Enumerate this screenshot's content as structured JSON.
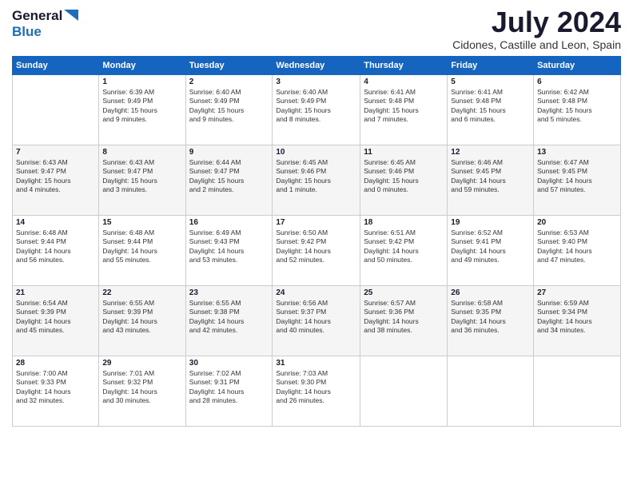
{
  "header": {
    "logo_general": "General",
    "logo_blue": "Blue",
    "month_title": "July 2024",
    "location": "Cidones, Castille and Leon, Spain"
  },
  "calendar": {
    "days_of_week": [
      "Sunday",
      "Monday",
      "Tuesday",
      "Wednesday",
      "Thursday",
      "Friday",
      "Saturday"
    ],
    "weeks": [
      [
        {
          "day": "",
          "info": ""
        },
        {
          "day": "1",
          "info": "Sunrise: 6:39 AM\nSunset: 9:49 PM\nDaylight: 15 hours\nand 9 minutes."
        },
        {
          "day": "2",
          "info": "Sunrise: 6:40 AM\nSunset: 9:49 PM\nDaylight: 15 hours\nand 9 minutes."
        },
        {
          "day": "3",
          "info": "Sunrise: 6:40 AM\nSunset: 9:49 PM\nDaylight: 15 hours\nand 8 minutes."
        },
        {
          "day": "4",
          "info": "Sunrise: 6:41 AM\nSunset: 9:48 PM\nDaylight: 15 hours\nand 7 minutes."
        },
        {
          "day": "5",
          "info": "Sunrise: 6:41 AM\nSunset: 9:48 PM\nDaylight: 15 hours\nand 6 minutes."
        },
        {
          "day": "6",
          "info": "Sunrise: 6:42 AM\nSunset: 9:48 PM\nDaylight: 15 hours\nand 5 minutes."
        }
      ],
      [
        {
          "day": "7",
          "info": "Sunrise: 6:43 AM\nSunset: 9:47 PM\nDaylight: 15 hours\nand 4 minutes."
        },
        {
          "day": "8",
          "info": "Sunrise: 6:43 AM\nSunset: 9:47 PM\nDaylight: 15 hours\nand 3 minutes."
        },
        {
          "day": "9",
          "info": "Sunrise: 6:44 AM\nSunset: 9:47 PM\nDaylight: 15 hours\nand 2 minutes."
        },
        {
          "day": "10",
          "info": "Sunrise: 6:45 AM\nSunset: 9:46 PM\nDaylight: 15 hours\nand 1 minute."
        },
        {
          "day": "11",
          "info": "Sunrise: 6:45 AM\nSunset: 9:46 PM\nDaylight: 15 hours\nand 0 minutes."
        },
        {
          "day": "12",
          "info": "Sunrise: 6:46 AM\nSunset: 9:45 PM\nDaylight: 14 hours\nand 59 minutes."
        },
        {
          "day": "13",
          "info": "Sunrise: 6:47 AM\nSunset: 9:45 PM\nDaylight: 14 hours\nand 57 minutes."
        }
      ],
      [
        {
          "day": "14",
          "info": "Sunrise: 6:48 AM\nSunset: 9:44 PM\nDaylight: 14 hours\nand 56 minutes."
        },
        {
          "day": "15",
          "info": "Sunrise: 6:48 AM\nSunset: 9:44 PM\nDaylight: 14 hours\nand 55 minutes."
        },
        {
          "day": "16",
          "info": "Sunrise: 6:49 AM\nSunset: 9:43 PM\nDaylight: 14 hours\nand 53 minutes."
        },
        {
          "day": "17",
          "info": "Sunrise: 6:50 AM\nSunset: 9:42 PM\nDaylight: 14 hours\nand 52 minutes."
        },
        {
          "day": "18",
          "info": "Sunrise: 6:51 AM\nSunset: 9:42 PM\nDaylight: 14 hours\nand 50 minutes."
        },
        {
          "day": "19",
          "info": "Sunrise: 6:52 AM\nSunset: 9:41 PM\nDaylight: 14 hours\nand 49 minutes."
        },
        {
          "day": "20",
          "info": "Sunrise: 6:53 AM\nSunset: 9:40 PM\nDaylight: 14 hours\nand 47 minutes."
        }
      ],
      [
        {
          "day": "21",
          "info": "Sunrise: 6:54 AM\nSunset: 9:39 PM\nDaylight: 14 hours\nand 45 minutes."
        },
        {
          "day": "22",
          "info": "Sunrise: 6:55 AM\nSunset: 9:39 PM\nDaylight: 14 hours\nand 43 minutes."
        },
        {
          "day": "23",
          "info": "Sunrise: 6:55 AM\nSunset: 9:38 PM\nDaylight: 14 hours\nand 42 minutes."
        },
        {
          "day": "24",
          "info": "Sunrise: 6:56 AM\nSunset: 9:37 PM\nDaylight: 14 hours\nand 40 minutes."
        },
        {
          "day": "25",
          "info": "Sunrise: 6:57 AM\nSunset: 9:36 PM\nDaylight: 14 hours\nand 38 minutes."
        },
        {
          "day": "26",
          "info": "Sunrise: 6:58 AM\nSunset: 9:35 PM\nDaylight: 14 hours\nand 36 minutes."
        },
        {
          "day": "27",
          "info": "Sunrise: 6:59 AM\nSunset: 9:34 PM\nDaylight: 14 hours\nand 34 minutes."
        }
      ],
      [
        {
          "day": "28",
          "info": "Sunrise: 7:00 AM\nSunset: 9:33 PM\nDaylight: 14 hours\nand 32 minutes."
        },
        {
          "day": "29",
          "info": "Sunrise: 7:01 AM\nSunset: 9:32 PM\nDaylight: 14 hours\nand 30 minutes."
        },
        {
          "day": "30",
          "info": "Sunrise: 7:02 AM\nSunset: 9:31 PM\nDaylight: 14 hours\nand 28 minutes."
        },
        {
          "day": "31",
          "info": "Sunrise: 7:03 AM\nSunset: 9:30 PM\nDaylight: 14 hours\nand 26 minutes."
        },
        {
          "day": "",
          "info": ""
        },
        {
          "day": "",
          "info": ""
        },
        {
          "day": "",
          "info": ""
        }
      ]
    ]
  }
}
